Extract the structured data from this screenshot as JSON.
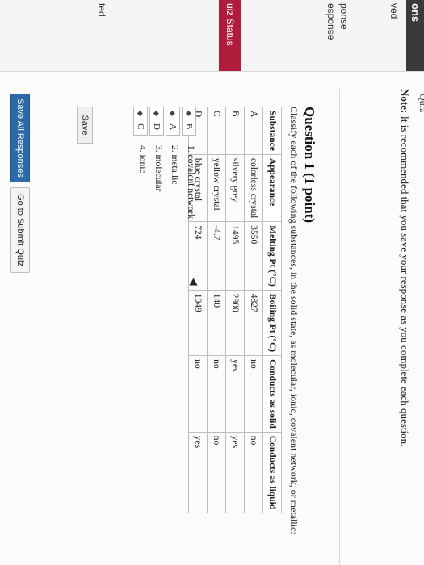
{
  "sidebar": {
    "top": "ons",
    "items": [
      "ved",
      "ponse",
      "esponse"
    ],
    "status": "uiz Status",
    "bottom": "ted"
  },
  "header": {
    "title_fragment": "Quiz",
    "note_label": "Note:",
    "note_text": "It is recommended that you save your response as you complete each question."
  },
  "question": {
    "title": "Question 1 (1 point)",
    "prompt": "Classify each of the following substances, in the solid state, as molecular, ionic, covalent network, or metallic:"
  },
  "table": {
    "headers": [
      "Substance",
      "Appearance",
      "Melting Pt (°C)",
      "Boiling Pt (°C)",
      "Conducts as solid",
      "Conducts as liquid"
    ],
    "rows": [
      [
        "A",
        "colorless crystal",
        "3550",
        "4827",
        "no",
        "no"
      ],
      [
        "B",
        "silvery grey",
        "1495",
        "2900",
        "yes",
        "yes"
      ],
      [
        "C",
        "yellow crystal",
        "-4.7",
        "140",
        "no",
        "no"
      ],
      [
        "D",
        "blue crystal",
        "724",
        "1049",
        "no",
        "yes"
      ]
    ]
  },
  "matching": {
    "selects": [
      "B",
      "A",
      "D",
      "C"
    ],
    "options": [
      "1. covalent network",
      "2. metallic",
      "3. molecular",
      "4. ionic"
    ]
  },
  "buttons": {
    "save": "Save",
    "save_all": "Save All Responses",
    "submit": "Go to Submit Quiz"
  },
  "icons": {
    "select_arrow": "updown-arrow-icon",
    "cursor": "mouse-pointer-icon"
  },
  "colors": {
    "status_bar": "#b01c3b",
    "primary_button": "#2e6aa8"
  }
}
